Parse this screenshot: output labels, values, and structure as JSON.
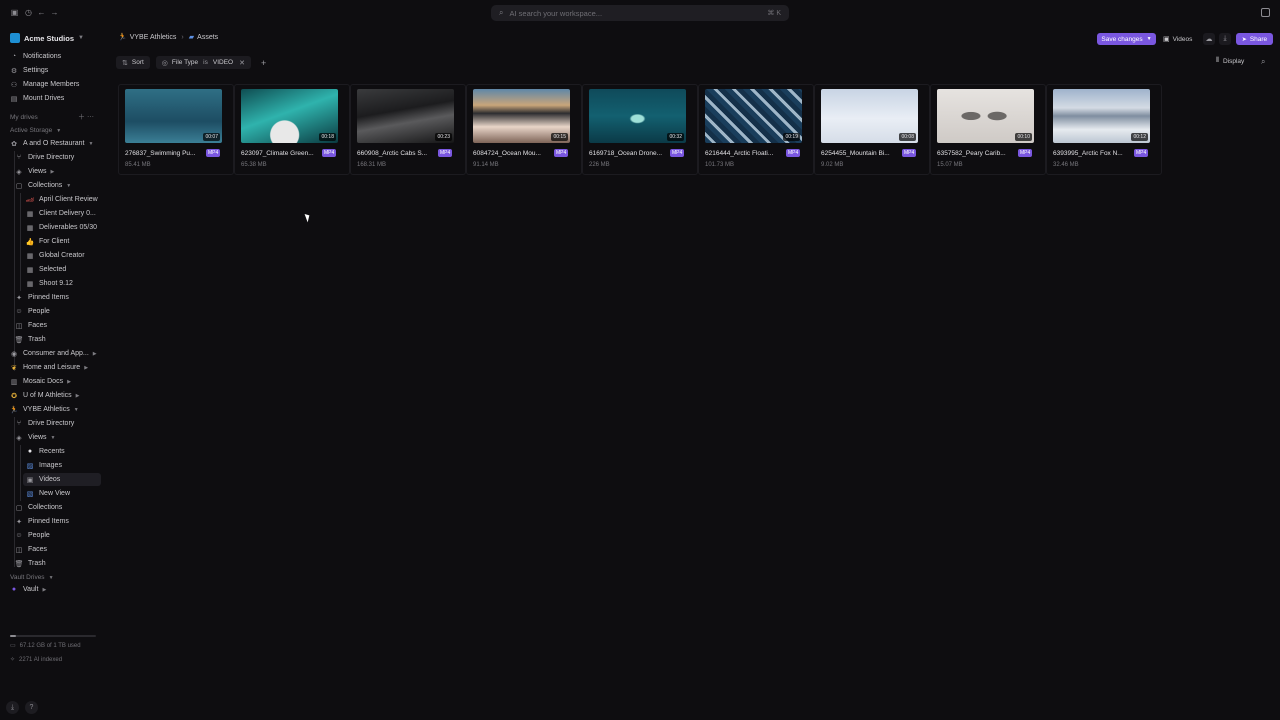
{
  "topbar": {
    "search_placeholder": "AI search your workspace...",
    "search_shortcut": "⌘ K"
  },
  "workspace": {
    "name": "Acme Studios"
  },
  "sidebar": {
    "top_items": [
      {
        "label": "Notifications",
        "icon": "bell-icon"
      },
      {
        "label": "Settings",
        "icon": "gear-icon"
      },
      {
        "label": "Manage Members",
        "icon": "users-icon"
      },
      {
        "label": "Mount Drives",
        "icon": "drive-icon"
      }
    ],
    "my_drives_label": "My drives",
    "active_storage_label": "Active Storage",
    "drives": [
      {
        "label": "A and O Restaurant"
      },
      {
        "label": "Drive Directory"
      },
      {
        "label": "Views"
      },
      {
        "label": "Collections"
      },
      {
        "label": "April Client Review"
      },
      {
        "label": "Client Delivery 0..."
      },
      {
        "label": "Deliverables 05/30"
      },
      {
        "label": "For Client"
      },
      {
        "label": "Global Creator"
      },
      {
        "label": "Selected"
      },
      {
        "label": "Shoot 9.12"
      },
      {
        "label": "Pinned Items"
      },
      {
        "label": "People"
      },
      {
        "label": "Faces"
      },
      {
        "label": "Trash"
      },
      {
        "label": "Consumer and App..."
      },
      {
        "label": "Home and Leisure"
      },
      {
        "label": "Mosaic Docs"
      },
      {
        "label": "U of M Athletics"
      },
      {
        "label": "VYBE Athletics"
      },
      {
        "label": "Drive Directory"
      },
      {
        "label": "Views"
      },
      {
        "label": "Recents"
      },
      {
        "label": "Images"
      },
      {
        "label": "Videos"
      },
      {
        "label": "New View"
      },
      {
        "label": "Collections"
      },
      {
        "label": "Pinned Items"
      },
      {
        "label": "People"
      },
      {
        "label": "Faces"
      },
      {
        "label": "Trash"
      }
    ],
    "vault_drives_label": "Vault Drives",
    "vault_label": "Vault",
    "usage_text": "67.12 GB of 1 TB used",
    "indexed_text": "2271 AI indexed",
    "usage_fraction": 0.067
  },
  "header": {
    "breadcrumb_drive": "VYBE Athletics",
    "breadcrumb_folder": "Assets",
    "save_changes": "Save changes",
    "view_name": "Videos",
    "share": "Share"
  },
  "filterbar": {
    "sort": "Sort",
    "filter_field": "File Type",
    "filter_op": "is",
    "filter_value": "VIDEO",
    "display": "Display"
  },
  "assets": [
    {
      "name": "276837_Swimming Pu...",
      "duration": "00:07",
      "type": "MP4",
      "size": "85.41 MB"
    },
    {
      "name": "623097_Climate Green...",
      "duration": "00:18",
      "type": "MP4",
      "size": "65.38 MB"
    },
    {
      "name": "660908_Arctic Cabs S...",
      "duration": "00:23",
      "type": "MP4",
      "size": "168.31 MB"
    },
    {
      "name": "6084724_Ocean Mou...",
      "duration": "00:15",
      "type": "MP4",
      "size": "91.14 MB"
    },
    {
      "name": "6169718_Ocean Drone...",
      "duration": "00:32",
      "type": "MP4",
      "size": "226 MB"
    },
    {
      "name": "6216444_Arctic Floati...",
      "duration": "00:19",
      "type": "MP4",
      "size": "101.73 MB"
    },
    {
      "name": "6254455_Mountain Bi...",
      "duration": "00:08",
      "type": "MP4",
      "size": "9.02 MB"
    },
    {
      "name": "6357582_Peary Carib...",
      "duration": "00:10",
      "type": "MP4",
      "size": "15.07 MB"
    },
    {
      "name": "6393995_Arctic Fox N...",
      "duration": "00:12",
      "type": "MP4",
      "size": "32.46 MB"
    }
  ]
}
